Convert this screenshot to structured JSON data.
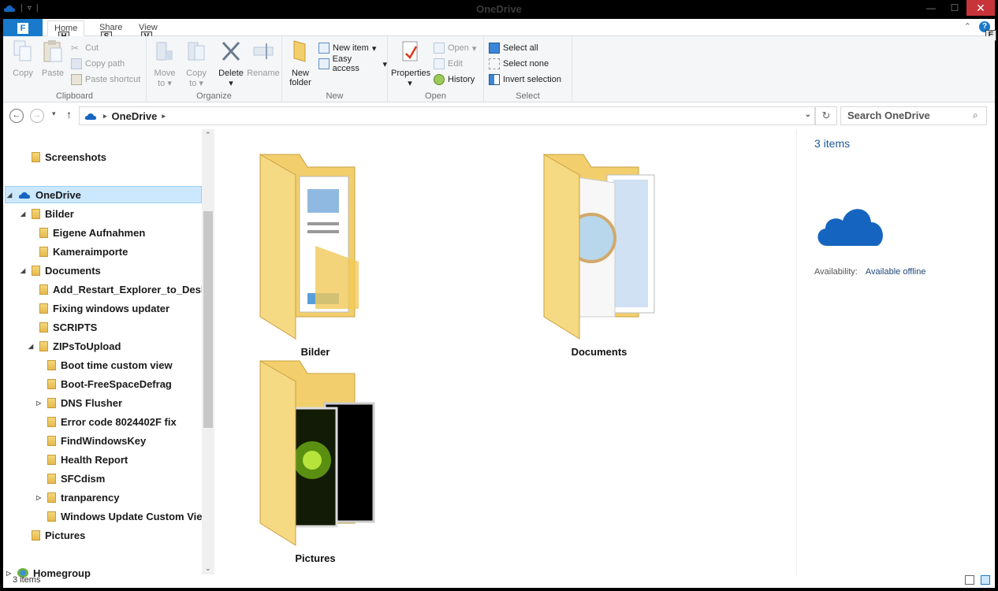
{
  "window": {
    "title": "OneDrive"
  },
  "tabs": {
    "file": "F",
    "home": "Home",
    "share": "Share",
    "view": "View",
    "keytips": {
      "home": "H",
      "share": "S",
      "view": "V",
      "help": "E"
    }
  },
  "ribbon": {
    "clipboard": {
      "label": "Clipboard",
      "copy": "Copy",
      "paste": "Paste",
      "cut": "Cut",
      "copy_path": "Copy path",
      "paste_shortcut": "Paste shortcut"
    },
    "organize": {
      "label": "Organize",
      "move_to": "Move",
      "move_to2": "to",
      "copy_to": "Copy",
      "copy_to2": "to",
      "delete": "Delete",
      "rename": "Rename"
    },
    "new": {
      "label": "New",
      "new_folder": "New",
      "new_folder2": "folder",
      "new_item": "New item",
      "easy_access": "Easy access"
    },
    "open": {
      "label": "Open",
      "properties": "Properties",
      "open": "Open",
      "edit": "Edit",
      "history": "History"
    },
    "select": {
      "label": "Select",
      "select_all": "Select all",
      "select_none": "Select none",
      "invert_selection": "Invert selection"
    }
  },
  "address": {
    "path": "OneDrive",
    "search_placeholder": "Search OneDrive"
  },
  "nav": {
    "items": [
      {
        "label": "Screenshots",
        "level": 1,
        "arrow": ""
      },
      {
        "label": "OneDrive",
        "level": 0,
        "arrow": "◢",
        "selected": true
      },
      {
        "label": "Bilder",
        "level": 1,
        "arrow": "◢"
      },
      {
        "label": "Eigene Aufnahmen",
        "level": 2,
        "arrow": ""
      },
      {
        "label": "Kameraimporte",
        "level": 2,
        "arrow": ""
      },
      {
        "label": "Documents",
        "level": 1,
        "arrow": "◢"
      },
      {
        "label": "Add_Restart_Explorer_to_Desktop",
        "level": 2,
        "arrow": ""
      },
      {
        "label": "Fixing windows updater",
        "level": 2,
        "arrow": ""
      },
      {
        "label": "SCRIPTS",
        "level": 2,
        "arrow": ""
      },
      {
        "label": "ZIPsToUpload",
        "level": 2,
        "arrow": "◢"
      },
      {
        "label": "Boot time custom view",
        "level": 3,
        "arrow": ""
      },
      {
        "label": "Boot-FreeSpaceDefrag",
        "level": 3,
        "arrow": ""
      },
      {
        "label": "DNS Flusher",
        "level": 3,
        "arrow": "▷"
      },
      {
        "label": "Error code 8024402F fix",
        "level": 3,
        "arrow": ""
      },
      {
        "label": "FindWindowsKey",
        "level": 3,
        "arrow": ""
      },
      {
        "label": "Health Report",
        "level": 3,
        "arrow": ""
      },
      {
        "label": "SFCdism",
        "level": 3,
        "arrow": ""
      },
      {
        "label": "tranparency",
        "level": 3,
        "arrow": "▷"
      },
      {
        "label": "Windows Update Custom View",
        "level": 3,
        "arrow": ""
      },
      {
        "label": "Pictures",
        "level": 1,
        "arrow": ""
      },
      {
        "label": "Homegroup",
        "level": 0,
        "arrow": "▷"
      }
    ]
  },
  "content": {
    "folders": [
      {
        "label": "Bilder",
        "kind": "documents-folder"
      },
      {
        "label": "Documents",
        "kind": "notebook-folder"
      },
      {
        "label": "Pictures",
        "kind": "pictures-folder"
      }
    ]
  },
  "details": {
    "count": "3 items",
    "availability_label": "Availability:",
    "availability_value": "Available offline"
  },
  "status": {
    "count": "3 items"
  },
  "colors": {
    "accent": "#1979ca",
    "selection": "#cce8ff",
    "cloud": "#1565c0"
  }
}
